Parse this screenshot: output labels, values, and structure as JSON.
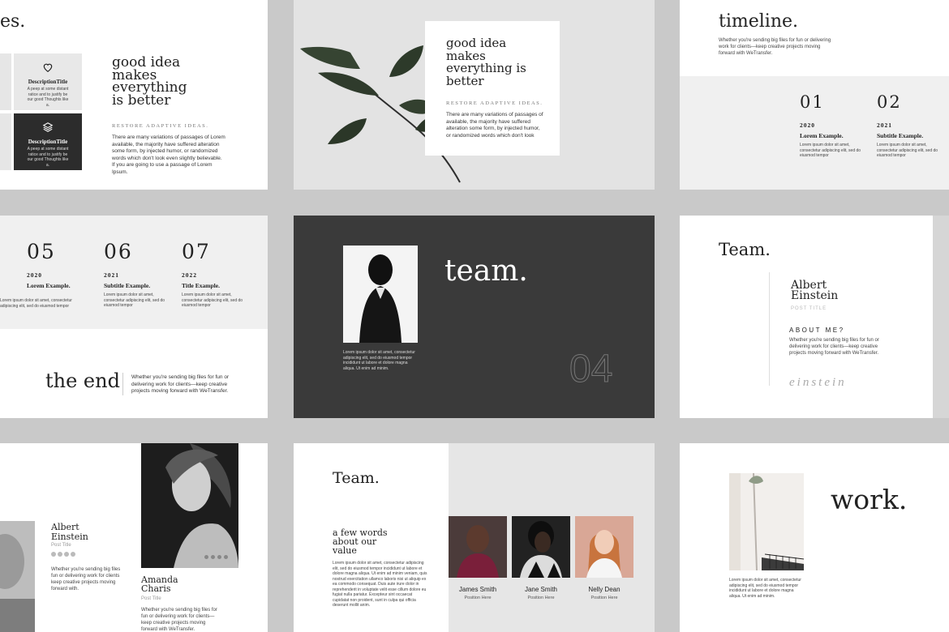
{
  "colors": {
    "background": "#c9c9c9",
    "dark_slide": "#3a3a3a",
    "light_panel": "#f0f0f0"
  },
  "s1": {
    "title_fragment": "es.",
    "card1": {
      "icon": "heart-outline-icon",
      "title": "DescriptionTitle",
      "text": "A peep at some distant ratice and to justify be our good Thoughts like a."
    },
    "card2": {
      "icon": "layers-icon",
      "title": "DescriptionTitle",
      "text": "A peep at some distant ratice and to justify be our good Thoughts like a."
    },
    "heading": "good idea makes everything is better",
    "subheading": "RESTORE ADAPTIVE IDEAS.",
    "body": "There are many variations of passages of Lorem available, the majority have suffered alteration some form, by injected humor, or randomized words which don't look even slightly believable. If you are going to use a passage of Lorem Ipsum."
  },
  "s2": {
    "heading": "good idea makes everything is better",
    "subheading": "RESTORE ADAPTIVE IDEAS.",
    "body": "There are many variations of passages of available, the majority have suffered alteration some form, by injected humor, or randomized words which don't look"
  },
  "s3": {
    "title": "timeline.",
    "intro": "Whether you're sending big files for fun or delivering work for clients—keep creative projects moving forward with WeTransfer.",
    "items": [
      {
        "num": "01",
        "year": "2020",
        "label": "Lorem Example.",
        "text": "Lorem ipsum dolor sit amet, consectetur adipiscing elit, sed do eiusmod tempor"
      },
      {
        "num": "02",
        "year": "2021",
        "label": "Subtitle Example.",
        "text": "Lorem ipsum dolor sit amet, consectetur adipiscing elit, sed do eiusmod tempor"
      }
    ]
  },
  "s4": {
    "items": [
      {
        "num": "05",
        "year": "2020",
        "label": "Lorem Example.",
        "text": "Lorem ipsum dolor sit amet, consectetur adipiscing elit, sed do eiusmod tempor"
      },
      {
        "num": "06",
        "year": "2021",
        "label": "Subtitle Example.",
        "text": "Lorem ipsum dolor sit amet, consectetur adipiscing elit, sed do eiusmod tempor"
      },
      {
        "num": "07",
        "year": "2022",
        "label": "Title Example.",
        "text": "Lorem ipsum dolor sit amet, consectetur adipiscing elit, sed do eiusmod tempor"
      }
    ],
    "end_title": "the end",
    "end_text": "Whether you're sending big files for fun or delivering work for clients—keep creative projects moving forward with WeTransfer."
  },
  "s5": {
    "title": "team.",
    "caption": "Lorem ipsum dolor sit amet, consectetur adipiscing elit, sed do eiusmod tempor incididunt ut labore et dolore magna aliqua. Ut enim ad minim.",
    "number": "04"
  },
  "s6": {
    "title": "Team.",
    "name": "Albert Einstein",
    "post": "POST TITLE",
    "about": "ABOUT ME?",
    "text": "Whether you're sending big files for fun or delivering work for clients—keep creative projects moving forward with WeTransfer.",
    "signature": "einstein"
  },
  "s7": {
    "person1": {
      "name": "Albert Einstein",
      "post": "Post Title",
      "text": "Whether you're sending big files fun or delivering work for clients keep creative projects moving forward with."
    },
    "person2": {
      "name": "Amanda Charis",
      "post": "Post Title",
      "text": "Whether you're sending big files for fun or delivering work for clients—keep creative projects moving forward with WeTransfer."
    }
  },
  "s8": {
    "title": "Team.",
    "subheading": "a few words about our value",
    "body": "Lorem ipsum dolor sit amet, consectetur adipiscing elit, sed do eiusmod tempor incididunt ut labore et dolore magna aliqua. Ut enim ad minim veniam, quis nostrud exercitation ullamco laboris nisi ut aliquip ex ea commodo consequat. Duis aute irure dolor in reprehenderit in voluptate velit esse cillum dolore eu fugiat nulla pariatur. Excepteur sint occaecat cupidatat non proident, sunt in culpa qui officia deserunt mollit anim.",
    "members": [
      {
        "name": "James Smith",
        "position": "Position Here"
      },
      {
        "name": "Jane Smith",
        "position": "Position Here"
      },
      {
        "name": "Nelly Dean",
        "position": "Position Here"
      }
    ]
  },
  "s9": {
    "title": "work.",
    "caption": "Lorem ipsum dolor sit amet, consectetur adipiscing elit, sed do eiusmod tempor incididunt ut labore et dolore magna aliqua. Ut enim ad minim."
  }
}
